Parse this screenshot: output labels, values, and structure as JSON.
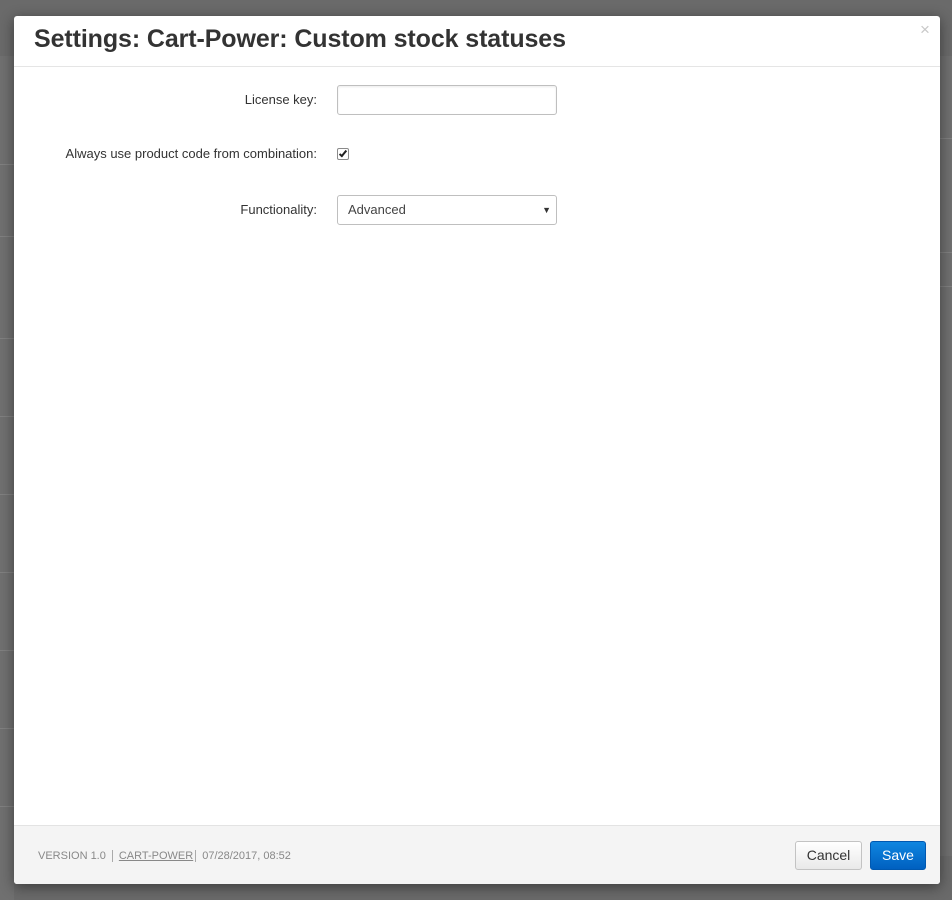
{
  "modal": {
    "title": "Settings: Cart-Power: Custom stock statuses",
    "close_symbol": "×"
  },
  "form": {
    "license_key": {
      "label": "License key:",
      "value": "",
      "placeholder": ""
    },
    "product_code": {
      "label": "Always use product code from combination:",
      "checked": true
    },
    "functionality": {
      "label": "Functionality:",
      "selected": "Advanced"
    }
  },
  "footer": {
    "version": "VERSION 1.0",
    "vendor_link": "CART-POWER",
    "date": "07/28/2017, 08:52",
    "cancel_label": "Cancel",
    "save_label": "Save"
  },
  "colors": {
    "save_button": "#0a6fd1",
    "footer_background": "#f4f4f4",
    "overlay": "#3f3f3f"
  },
  "icons": {
    "close": "close-icon",
    "checkbox": "checkmark-icon",
    "select_caret": "caret-down-icon"
  }
}
